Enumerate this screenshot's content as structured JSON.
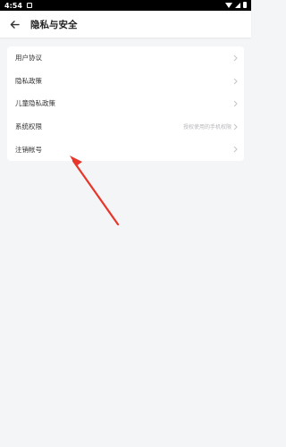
{
  "status_bar": {
    "time": "4:54"
  },
  "header": {
    "title": "隐私与安全"
  },
  "settings": {
    "items": [
      {
        "label": "用户协议",
        "hint": ""
      },
      {
        "label": "隐私政策",
        "hint": ""
      },
      {
        "label": "儿童隐私政策",
        "hint": ""
      },
      {
        "label": "系统权限",
        "hint": "授权使用的手机权限"
      },
      {
        "label": "注销帐号",
        "hint": ""
      }
    ]
  },
  "colors": {
    "background": "#f4f5f7",
    "card": "#ffffff",
    "annotation_arrow": "#e8362b"
  }
}
